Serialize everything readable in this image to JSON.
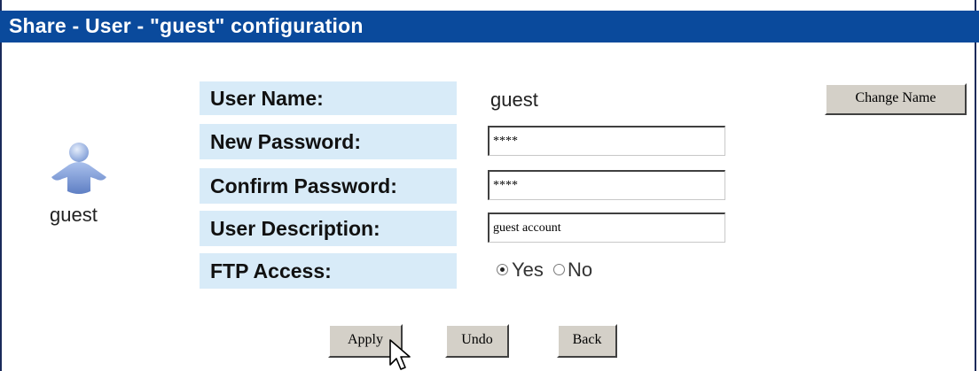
{
  "title": "Share - User - \"guest\" configuration",
  "user_icon_label": "guest",
  "form": {
    "user_name_label": "User Name:",
    "user_name_value": "guest",
    "new_password_label": "New Password:",
    "new_password_value": "****",
    "confirm_password_label": "Confirm Password:",
    "confirm_password_value": "****",
    "user_description_label": "User Description:",
    "user_description_value": "guest account",
    "ftp_access_label": "FTP Access:",
    "ftp_yes_label": "Yes",
    "ftp_no_label": "No",
    "ftp_selected": "Yes"
  },
  "buttons": {
    "change_name": "Change Name",
    "apply": "Apply",
    "undo": "Undo",
    "back": "Back"
  },
  "colors": {
    "title_bar": "#0a4a9c",
    "label_background": "#d8ebf8",
    "button_face": "#d4d0c8"
  },
  "icons": {
    "user": "user-avatar-icon",
    "pointer": "mouse-cursor-icon"
  }
}
